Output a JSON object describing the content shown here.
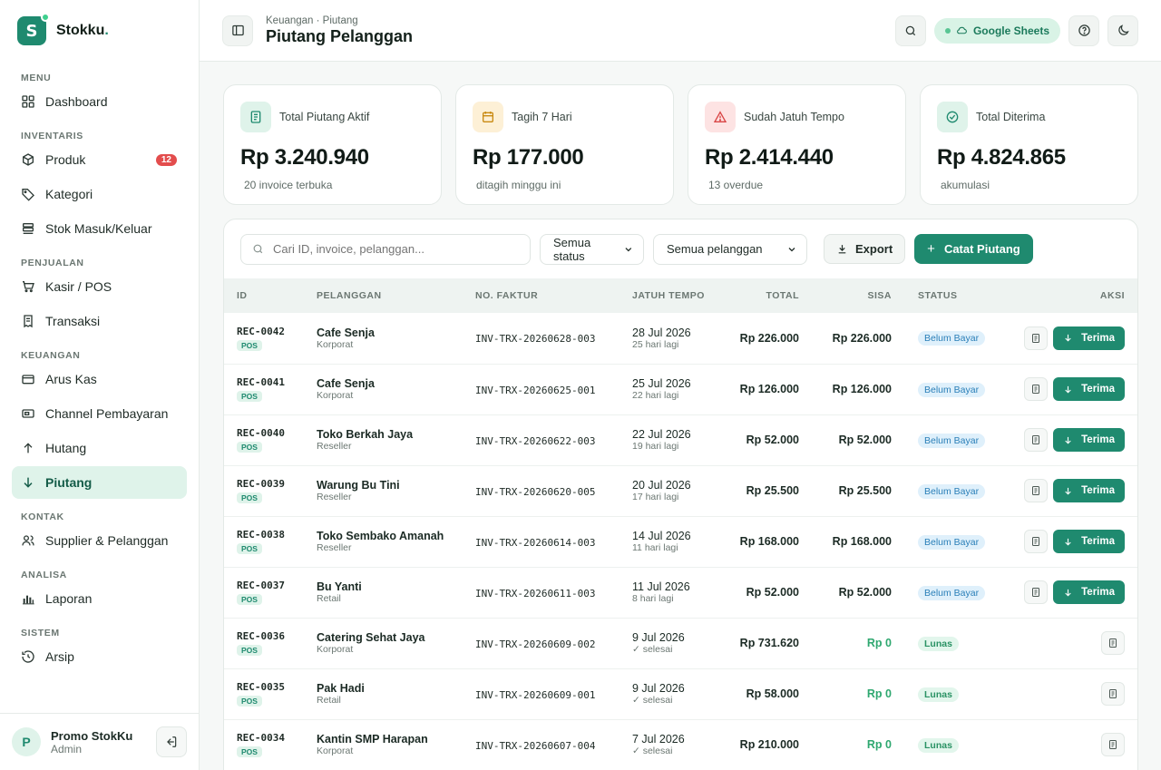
{
  "brand": {
    "name": "Stokku",
    "dot": ".",
    "logo_letter": "S"
  },
  "sidebar": {
    "sections": [
      {
        "title": "MENU",
        "items": [
          {
            "label": "Dashboard",
            "icon": "grid-icon"
          }
        ]
      },
      {
        "title": "INVENTARIS",
        "items": [
          {
            "label": "Produk",
            "icon": "box-icon",
            "badge": "12"
          },
          {
            "label": "Kategori",
            "icon": "tag-icon"
          },
          {
            "label": "Stok Masuk/Keluar",
            "icon": "layers-icon"
          }
        ]
      },
      {
        "title": "PENJUALAN",
        "items": [
          {
            "label": "Kasir / POS",
            "icon": "cart-icon"
          },
          {
            "label": "Transaksi",
            "icon": "receipt-icon"
          }
        ]
      },
      {
        "title": "KEUANGAN",
        "items": [
          {
            "label": "Arus Kas",
            "icon": "wallet-icon"
          },
          {
            "label": "Channel Pembayaran",
            "icon": "card-icon"
          },
          {
            "label": "Hutang",
            "icon": "arrow-up-icon"
          },
          {
            "label": "Piutang",
            "icon": "arrow-down-icon",
            "active": true
          }
        ]
      },
      {
        "title": "KONTAK",
        "items": [
          {
            "label": "Supplier & Pelanggan",
            "icon": "users-icon"
          }
        ]
      },
      {
        "title": "ANALISA",
        "items": [
          {
            "label": "Laporan",
            "icon": "bar-chart-icon"
          }
        ]
      },
      {
        "title": "SISTEM",
        "items": [
          {
            "label": "Arsip",
            "icon": "history-icon"
          }
        ]
      }
    ],
    "user": {
      "initial": "P",
      "name": "Promo StokKu",
      "role": "Admin"
    }
  },
  "header": {
    "breadcrumb": "Keuangan · Piutang",
    "title": "Piutang Pelanggan",
    "sheets_label": "Google Sheets"
  },
  "stats": [
    {
      "label": "Total Piutang Aktif",
      "value": "Rp 3.240.940",
      "sub": "20 invoice terbuka",
      "icon": "document-icon",
      "bg": "#dff3ea",
      "fg": "#1f8a6f"
    },
    {
      "label": "Tagih 7 Hari",
      "value": "Rp 177.000",
      "sub": "ditagih minggu ini",
      "icon": "calendar-icon",
      "bg": "#fdf0d6",
      "fg": "#c98a12"
    },
    {
      "label": "Sudah Jatuh Tempo",
      "value": "Rp 2.414.440",
      "sub": "13 overdue",
      "icon": "warning-icon",
      "bg": "#fde3e3",
      "fg": "#d94545"
    },
    {
      "label": "Total Diterima",
      "value": "Rp 4.824.865",
      "sub": "akumulasi",
      "icon": "check-circle-icon",
      "bg": "#dff3ea",
      "fg": "#1f8a6f"
    }
  ],
  "toolbar": {
    "search_placeholder": "Cari ID, invoice, pelanggan...",
    "status_filter": "Semua status",
    "customer_filter": "Semua pelanggan",
    "export_label": "Export",
    "add_label": "Catat Piutang"
  },
  "table": {
    "columns": [
      "ID",
      "PELANGGAN",
      "NO. FAKTUR",
      "JATUH TEMPO",
      "TOTAL",
      "SISA",
      "STATUS",
      "AKSI"
    ],
    "action_label": "Terima",
    "rows": [
      {
        "id": "REC-0042",
        "tag": "POS",
        "name": "Cafe Senja",
        "type": "Korporat",
        "invoice": "INV-TRX-20260628-003",
        "due": "28 Jul 2026",
        "due_sub": "25 hari lagi",
        "total": "Rp 226.000",
        "remaining": "Rp 226.000",
        "status": "Belum Bayar",
        "paid": false
      },
      {
        "id": "REC-0041",
        "tag": "POS",
        "name": "Cafe Senja",
        "type": "Korporat",
        "invoice": "INV-TRX-20260625-001",
        "due": "25 Jul 2026",
        "due_sub": "22 hari lagi",
        "total": "Rp 126.000",
        "remaining": "Rp 126.000",
        "status": "Belum Bayar",
        "paid": false
      },
      {
        "id": "REC-0040",
        "tag": "POS",
        "name": "Toko Berkah Jaya",
        "type": "Reseller",
        "invoice": "INV-TRX-20260622-003",
        "due": "22 Jul 2026",
        "due_sub": "19 hari lagi",
        "total": "Rp 52.000",
        "remaining": "Rp 52.000",
        "status": "Belum Bayar",
        "paid": false
      },
      {
        "id": "REC-0039",
        "tag": "POS",
        "name": "Warung Bu Tini",
        "type": "Reseller",
        "invoice": "INV-TRX-20260620-005",
        "due": "20 Jul 2026",
        "due_sub": "17 hari lagi",
        "total": "Rp 25.500",
        "remaining": "Rp 25.500",
        "status": "Belum Bayar",
        "paid": false
      },
      {
        "id": "REC-0038",
        "tag": "POS",
        "name": "Toko Sembako Amanah",
        "type": "Reseller",
        "invoice": "INV-TRX-20260614-003",
        "due": "14 Jul 2026",
        "due_sub": "11 hari lagi",
        "total": "Rp 168.000",
        "remaining": "Rp 168.000",
        "status": "Belum Bayar",
        "paid": false
      },
      {
        "id": "REC-0037",
        "tag": "POS",
        "name": "Bu Yanti",
        "type": "Retail",
        "invoice": "INV-TRX-20260611-003",
        "due": "11 Jul 2026",
        "due_sub": "8 hari lagi",
        "total": "Rp 52.000",
        "remaining": "Rp 52.000",
        "status": "Belum Bayar",
        "paid": false
      },
      {
        "id": "REC-0036",
        "tag": "POS",
        "name": "Catering Sehat Jaya",
        "type": "Korporat",
        "invoice": "INV-TRX-20260609-002",
        "due": "9 Jul 2026",
        "due_sub": "✓ selesai",
        "total": "Rp 731.620",
        "remaining": "Rp 0",
        "status": "Lunas",
        "paid": true
      },
      {
        "id": "REC-0035",
        "tag": "POS",
        "name": "Pak Hadi",
        "type": "Retail",
        "invoice": "INV-TRX-20260609-001",
        "due": "9 Jul 2026",
        "due_sub": "✓ selesai",
        "total": "Rp 58.000",
        "remaining": "Rp 0",
        "status": "Lunas",
        "paid": true
      },
      {
        "id": "REC-0034",
        "tag": "POS",
        "name": "Kantin SMP Harapan",
        "type": "Korporat",
        "invoice": "INV-TRX-20260607-004",
        "due": "7 Jul 2026",
        "due_sub": "✓ selesai",
        "total": "Rp 210.000",
        "remaining": "Rp 0",
        "status": "Lunas",
        "paid": true
      }
    ]
  }
}
